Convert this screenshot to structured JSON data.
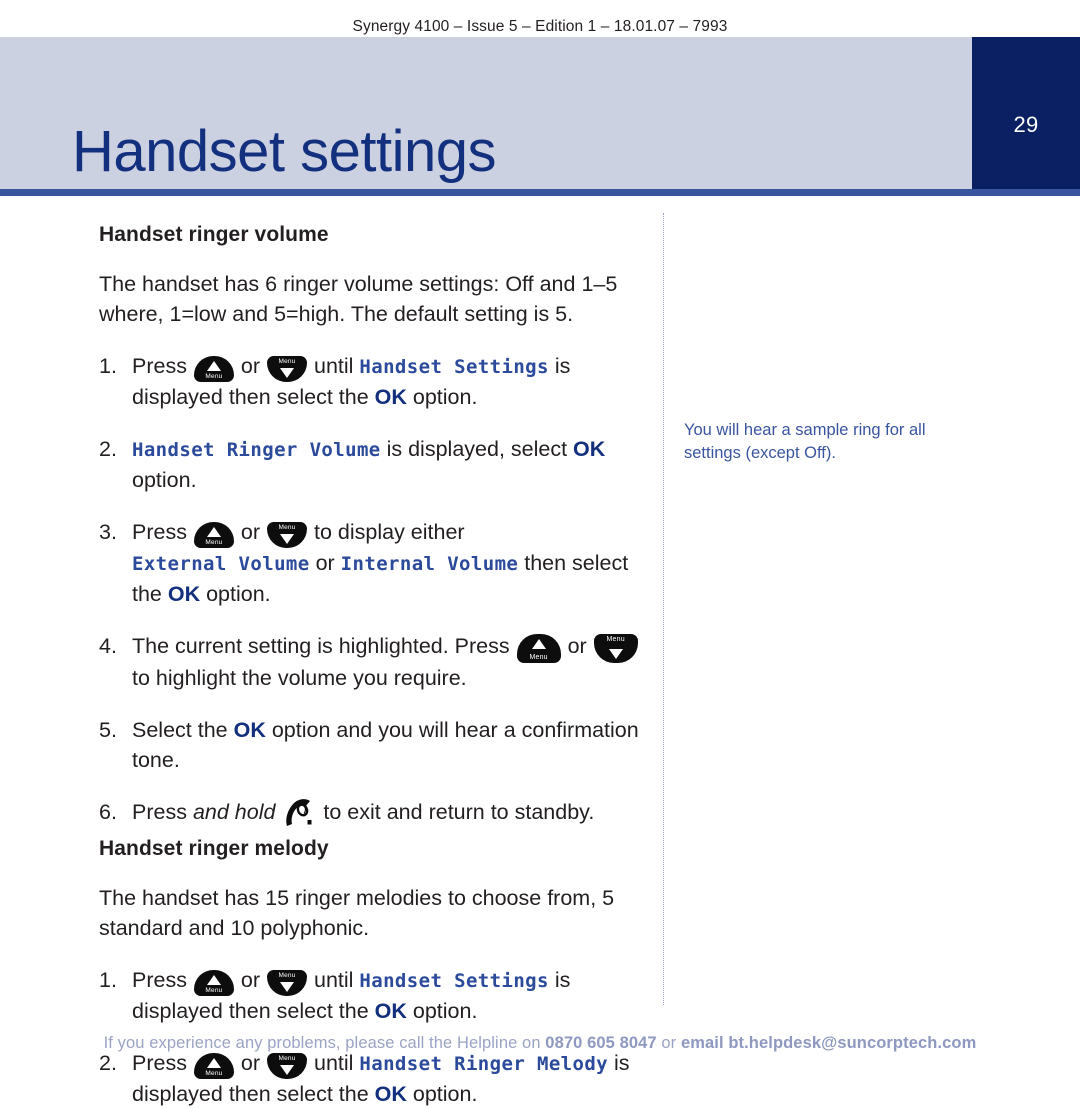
{
  "running_head": "Synergy 4100 – Issue 5 – Edition 1 – 18.01.07 – 7993",
  "header": {
    "chapter_title": "Handset settings",
    "page_number": "29",
    "band_color": "#ccd1e2",
    "page_number_block_color": "#0b2063",
    "rule_color": "#3a55a0",
    "title_color": "#13307e"
  },
  "sections": [
    {
      "heading": "Handset ringer volume",
      "intro": "The handset has 6 ringer volume settings: Off and 1–5 where, 1=low and 5=high. The default setting is 5.",
      "steps": [
        {
          "num": "1.",
          "parts": [
            {
              "t": "text",
              "v": "Press "
            },
            {
              "t": "key-up",
              "v": "Menu"
            },
            {
              "t": "text",
              "v": " or "
            },
            {
              "t": "key-down",
              "v": "Menu"
            },
            {
              "t": "text",
              "v": " until "
            },
            {
              "t": "lcd",
              "v": "Handset Settings"
            },
            {
              "t": "text",
              "v": " is displayed then select the "
            },
            {
              "t": "ok",
              "v": "OK"
            },
            {
              "t": "text",
              "v": " option."
            }
          ]
        },
        {
          "num": "2.",
          "parts": [
            {
              "t": "lcd",
              "v": "Handset Ringer Volume"
            },
            {
              "t": "text",
              "v": " is displayed, select "
            },
            {
              "t": "ok",
              "v": "OK"
            },
            {
              "t": "text",
              "v": " option."
            }
          ]
        },
        {
          "num": "3.",
          "parts": [
            {
              "t": "text",
              "v": "Press "
            },
            {
              "t": "key-up",
              "v": "Menu"
            },
            {
              "t": "text",
              "v": " or "
            },
            {
              "t": "key-down",
              "v": "Menu"
            },
            {
              "t": "text",
              "v": " to display either "
            },
            {
              "t": "lcd",
              "v": "External Volume"
            },
            {
              "t": "text",
              "v": " or "
            },
            {
              "t": "lcd",
              "v": "Internal Volume"
            },
            {
              "t": "text",
              "v": " then select the "
            },
            {
              "t": "ok",
              "v": "OK"
            },
            {
              "t": "text",
              "v": " option."
            }
          ]
        },
        {
          "num": "4.",
          "parts": [
            {
              "t": "text",
              "v": "The current setting is highlighted. Press "
            },
            {
              "t": "key-up-big",
              "v": "Menu"
            },
            {
              "t": "text",
              "v": " or "
            },
            {
              "t": "key-down-big",
              "v": "Menu"
            },
            {
              "t": "text",
              "v": " to highlight the volume you require."
            }
          ]
        },
        {
          "num": "5.",
          "parts": [
            {
              "t": "text",
              "v": "Select the "
            },
            {
              "t": "ok",
              "v": "OK"
            },
            {
              "t": "text",
              "v": " option and you will hear a confirmation tone."
            }
          ]
        },
        {
          "num": "6.",
          "parts": [
            {
              "t": "text",
              "v": "Press "
            },
            {
              "t": "italic",
              "v": "and hold"
            },
            {
              "t": "text",
              "v": " "
            },
            {
              "t": "endcall",
              "v": "end-call-key"
            },
            {
              "t": "text",
              "v": " to exit and return to standby."
            }
          ]
        }
      ]
    },
    {
      "heading": "Handset ringer melody",
      "intro": "The handset has 15 ringer melodies to choose from, 5 standard and 10 polyphonic.",
      "steps": [
        {
          "num": "1.",
          "parts": [
            {
              "t": "text",
              "v": "Press "
            },
            {
              "t": "key-up",
              "v": "Menu"
            },
            {
              "t": "text",
              "v": " or "
            },
            {
              "t": "key-down",
              "v": "Menu"
            },
            {
              "t": "text",
              "v": " until "
            },
            {
              "t": "lcd",
              "v": "Handset Settings"
            },
            {
              "t": "text",
              "v": " is displayed then select the "
            },
            {
              "t": "ok",
              "v": "OK"
            },
            {
              "t": "text",
              "v": " option."
            }
          ]
        },
        {
          "num": "2.",
          "parts": [
            {
              "t": "text",
              "v": "Press "
            },
            {
              "t": "key-up",
              "v": "Menu"
            },
            {
              "t": "text",
              "v": " or "
            },
            {
              "t": "key-down",
              "v": "Menu"
            },
            {
              "t": "text",
              "v": " until "
            },
            {
              "t": "lcd",
              "v": "Handset Ringer Melody"
            },
            {
              "t": "text",
              "v": " is displayed then select the "
            },
            {
              "t": "ok",
              "v": "OK"
            },
            {
              "t": "text",
              "v": " option."
            }
          ]
        }
      ]
    }
  ],
  "side_note": "You will hear a sample ring for all settings (except Off).",
  "footer": {
    "lead": "If you experience any problems, please call the Helpline on ",
    "phone": "0870 605 8047",
    "mid": " or ",
    "email": "email bt.helpdesk@suncorptech.com",
    "color": "#9aa3c4"
  }
}
